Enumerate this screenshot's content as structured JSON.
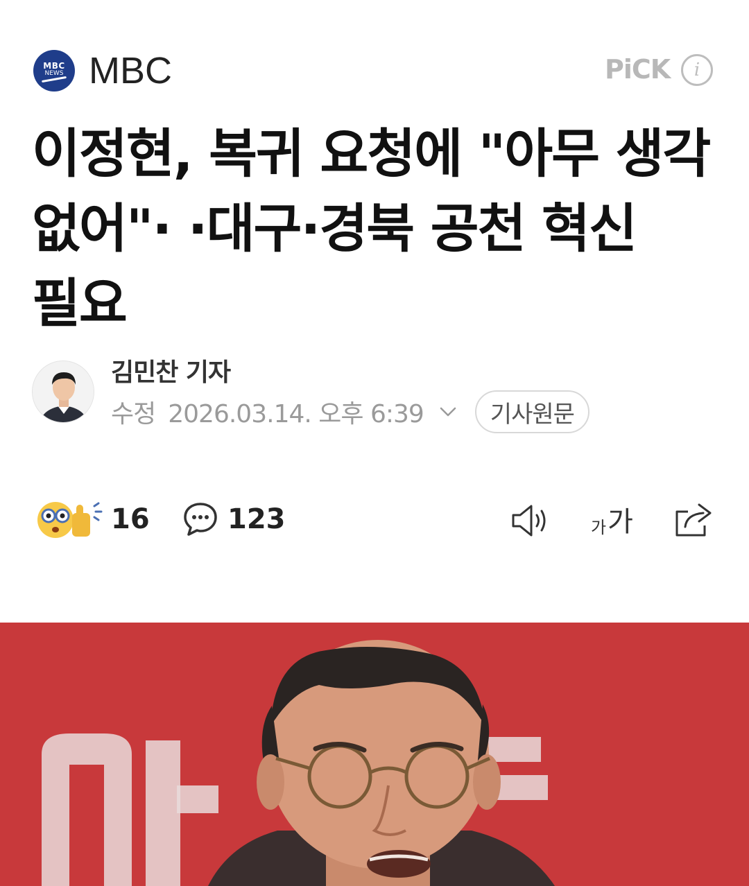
{
  "press": {
    "logo_line1": "MBC",
    "logo_line2": "NEWS",
    "name": "MBC",
    "pick_label": "PiCK",
    "brand_color": "#1f3d8a"
  },
  "article": {
    "headline": "이정현, 복귀 요청에 \"아무 생각 없어\"· ·대구·경북 공천 혁신 필요"
  },
  "byline": {
    "reporter": "김민찬 기자",
    "date_label": "수정",
    "date_value": "2026.03.14. 오후 6:39",
    "origin_button": "기사원문"
  },
  "actions": {
    "reaction_count": "16",
    "comment_count": "123",
    "font_small": "가",
    "font_big": "가"
  },
  "icons": [
    "info-icon",
    "chevron-down-icon",
    "reaction-emoji-icon",
    "comment-icon",
    "speaker-icon",
    "font-size-icon",
    "share-icon"
  ],
  "colors": {
    "photo_background": "#c8393b",
    "muted_text": "#9a9a9a"
  }
}
